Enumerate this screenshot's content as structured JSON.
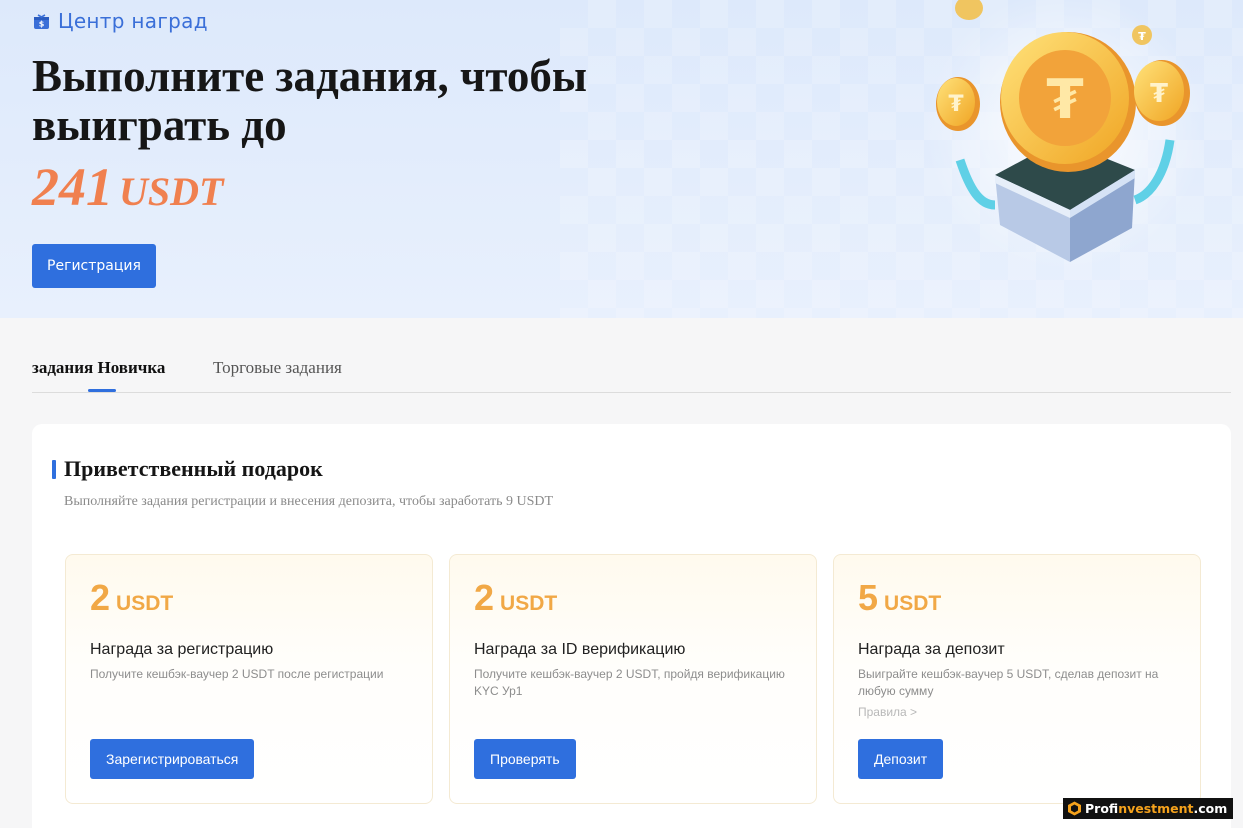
{
  "header": {
    "breadcrumb": "Центр наград",
    "title": "Выполните задания, чтобы выиграть до",
    "amount_value": "241",
    "amount_currency": "USDT",
    "register_button": "Регистрация"
  },
  "tabs": [
    {
      "label": "задания Новичка",
      "active": true
    },
    {
      "label": "Торговые задания",
      "active": false
    }
  ],
  "section": {
    "title": "Приветственный подарок",
    "subtitle": "Выполняйте задания регистрации и внесения депозита, чтобы заработать 9 USDT"
  },
  "cards": [
    {
      "amount": "2",
      "currency": "USDT",
      "title": "Награда за регистрацию",
      "description": "Получите кешбэк-ваучер 2 USDT после регистрации",
      "button": "Зарегистрироваться"
    },
    {
      "amount": "2",
      "currency": "USDT",
      "title": "Награда за ID верификацию",
      "description": "Получите кешбэк-ваучер 2 USDT, пройдя верификацию KYC Ур1",
      "button": "Проверять"
    },
    {
      "amount": "5",
      "currency": "USDT",
      "title": "Награда за депозит",
      "description": "Выиграйте кешбэк-ваучер 5 USDT, сделав депозит на любую сумму",
      "link": "Правила >",
      "button": "Депозит"
    }
  ],
  "watermark": {
    "part1": "Prof",
    "part2": "investment",
    "part3": ".com"
  },
  "colors": {
    "accent": "#2f6fde",
    "amount": "#f0804f",
    "card_amount": "#f1a846"
  }
}
